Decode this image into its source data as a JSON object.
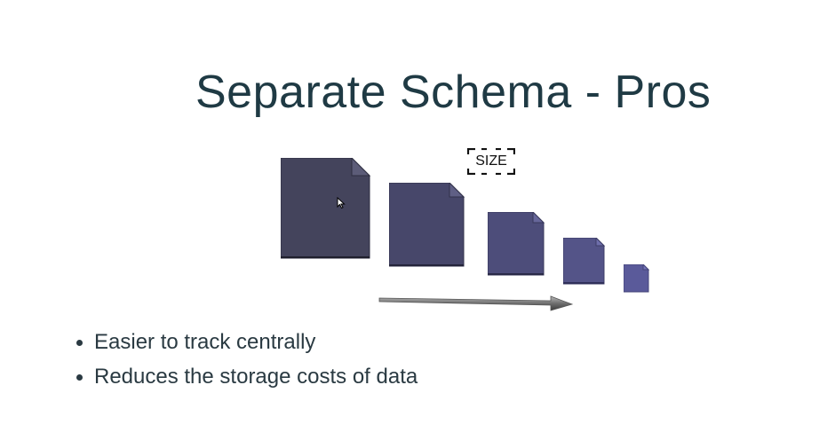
{
  "slide": {
    "title": "Separate Schema - Pros",
    "size_label": "SIZE",
    "bullets": [
      "Easier to track centrally",
      "Reduces the storage costs of data"
    ],
    "colors": {
      "title": "#1f3a44",
      "document_largest": "#44445c",
      "document_smallest": "#5a5a9a",
      "arrow": "#6f6f6f"
    },
    "icons": [
      "document-icon",
      "arrow-icon",
      "pointer-cursor-icon",
      "size-bracket-icon"
    ]
  }
}
